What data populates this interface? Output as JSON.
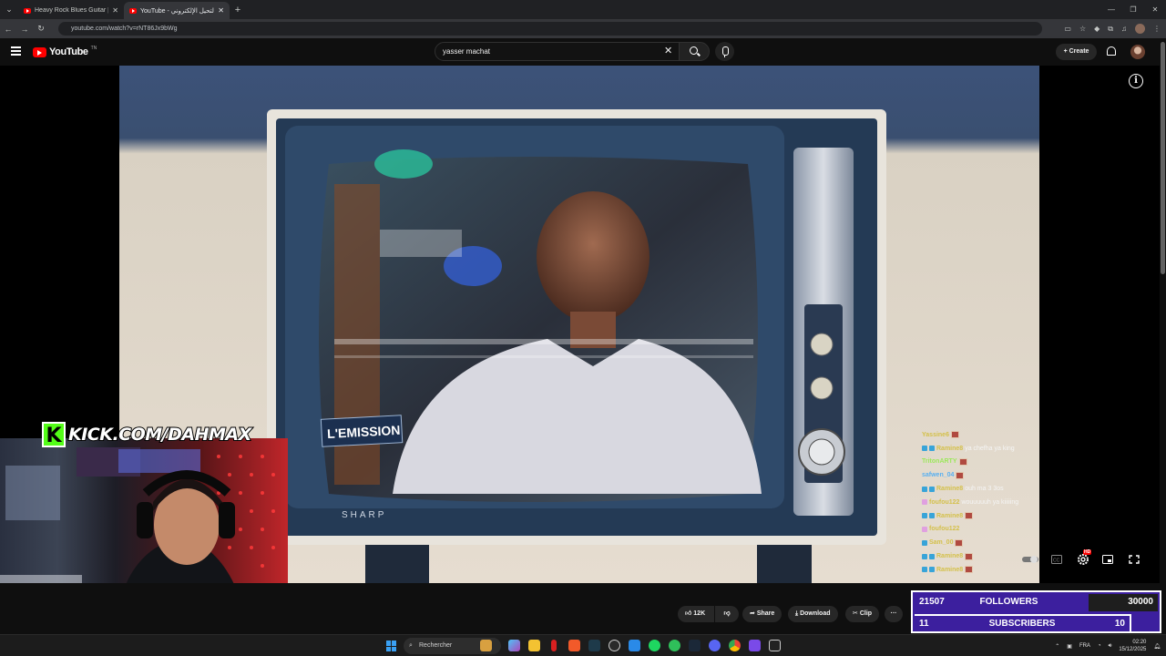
{
  "browser": {
    "tabs": [
      {
        "title": "Heavy Rock Blues Guitar | High",
        "active": false
      },
      {
        "title": "YouTube - التحيل الإلكتروني",
        "active": true
      }
    ],
    "url": "youtube.com/watch?v=rNT86Jx9bWg"
  },
  "youtube": {
    "logo_text": "YouTube",
    "logo_sup": "TN",
    "search_value": "yasser machat",
    "create_label": "Create"
  },
  "overlay": {
    "kick_banner": "KICK.COM/DAHMAX",
    "chat": [
      {
        "user": "Yassine6",
        "msg": ""
      },
      {
        "user": "Ramine8",
        "msg": "ya chefha ya king"
      },
      {
        "user": "TritonARTY",
        "msg": ""
      },
      {
        "user": "safwen_04",
        "msg": ""
      },
      {
        "user": "Ramine8",
        "msg": "ouh ma 3 3os"
      },
      {
        "user": "foufou122",
        "msg": "wouuuuuh ya kiiiiing"
      },
      {
        "user": "Ramine8",
        "msg": ""
      },
      {
        "user": "foufou122",
        "msg": ""
      },
      {
        "user": "Sam_00",
        "msg": ""
      },
      {
        "user": "Ramine8",
        "msg": ""
      },
      {
        "user": "Ramine8",
        "msg": ""
      }
    ],
    "stats": {
      "followers_count": "21507",
      "followers_label": "FOLLOWERS",
      "followers_goal": "30000",
      "followers_progress": 0.717,
      "subscribers_count": "11",
      "subscribers_label": "SUBSCRIBERS",
      "subscribers_goal": "10",
      "subscribers_progress": 1.0
    }
  },
  "actions": {
    "likes": "12K",
    "share": "Share",
    "download": "Download",
    "clip": "Clip",
    "more": "···"
  },
  "player": {
    "hd_badge": "HD",
    "tv_caption": "L'EMISSION",
    "tv_brand": "SHARP"
  },
  "taskbar": {
    "search_placeholder": "Rechercher",
    "language": "FRA",
    "time": "02:20",
    "date": "15/12/2025"
  },
  "colors": {
    "accent_red": "#ff0000",
    "kick_green": "#53fc18",
    "stats_purple": "#3c1f9e"
  }
}
